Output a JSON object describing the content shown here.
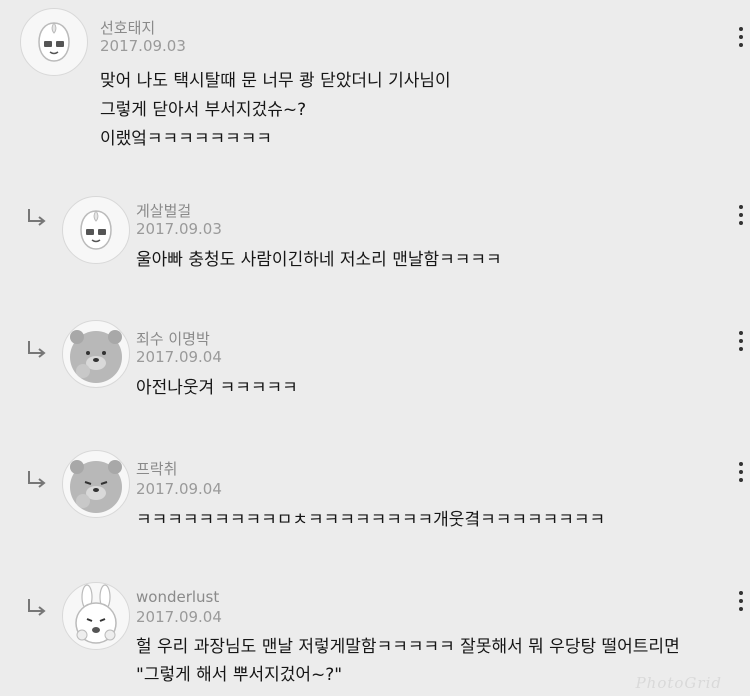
{
  "comments": [
    {
      "username": "선호태지",
      "date": "2017.09.03",
      "lines": [
        "맞어 나도 택시탈때 문 너무 쾅 닫았더니 기사님이",
        "그렇게 닫아서 부서지겄슈~?",
        "이랬엌ㅋㅋㅋㅋㅋㅋㅋㅋ"
      ],
      "avatar": "peach-avatar"
    },
    {
      "username": "게살벌걸",
      "date": "2017.09.03",
      "lines": [
        "울아빠 충청도 사람이긴하네 저소리 맨날함ㅋㅋㅋㅋ"
      ],
      "avatar": "peach-avatar"
    },
    {
      "username": "죄수 이명박",
      "date": "2017.09.04",
      "lines": [
        "아전나웃겨 ㅋㅋㅋㅋㅋ"
      ],
      "avatar": "bear-avatar"
    },
    {
      "username": "프락취",
      "date": "2017.09.04",
      "lines": [
        "ㅋㅋㅋㅋㅋㅋㅋㅋㅋㅁㅊㅋㅋㅋㅋㅋㅋㅋㅋ개웃곀ㅋㅋㅋㅋㅋㅋㅋㅋ"
      ],
      "avatar": "bear-avatar"
    },
    {
      "username": "wonderlust",
      "date": "2017.09.04",
      "lines": [
        "헐 우리 과장님도 맨날 저렇게말함ㅋㅋㅋㅋㅋ 잘못해서 뭐 우당탕 떨어트리면",
        "\"그렇게 해서 뿌서지겄어~?\""
      ],
      "avatar": "rabbit-avatar"
    }
  ],
  "watermark": "PhotoGrid",
  "colors": {
    "background": "#ececec",
    "meta_text": "#8a8a8a",
    "body_text": "#161616"
  }
}
